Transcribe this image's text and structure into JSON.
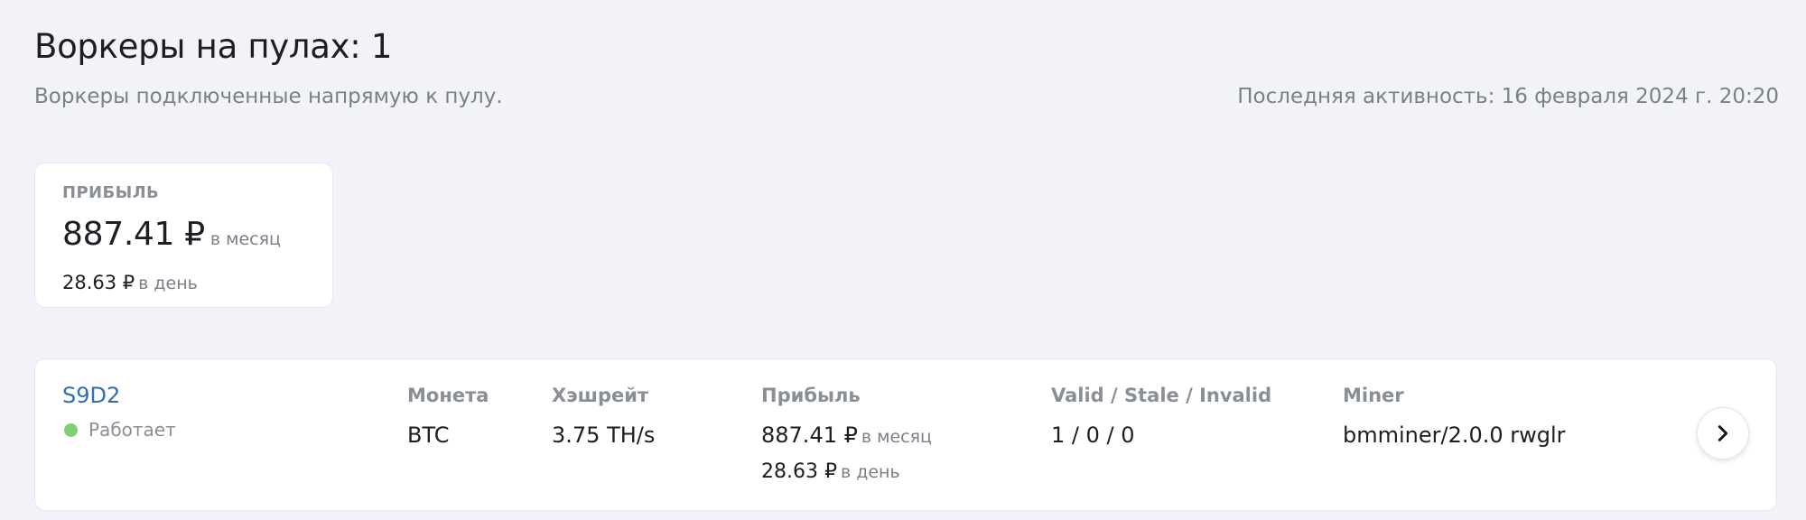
{
  "header": {
    "title": "Воркеры на пулах: 1",
    "subtitle": "Воркеры подключенные напрямую к пулу.",
    "last_activity": "Последняя активность: 16 февраля 2024 г. 20:20"
  },
  "profit_card": {
    "label": "ПРИБЫЛЬ",
    "monthly_value": "887.41 ₽",
    "monthly_unit": "в месяц",
    "daily_value": "28.63 ₽",
    "daily_unit": "в день"
  },
  "worker": {
    "name": "S9D2",
    "status": "Работает",
    "status_color": "#7fcf74",
    "coin_header": "Монета",
    "coin": "BTC",
    "hashrate_header": "Хэшрейт",
    "hashrate": "3.75 TH/s",
    "profit_header": "Прибыль",
    "profit_monthly_value": "887.41 ₽",
    "profit_monthly_unit": "в месяц",
    "profit_daily_value": "28.63 ₽",
    "profit_daily_unit": "в день",
    "shares_header": "Valid / Stale / Invalid",
    "shares": "1 / 0 / 0",
    "miner_header": "Miner",
    "miner": "bmminer/2.0.0 rwglr",
    "open_icon": "chevron-right-icon"
  }
}
